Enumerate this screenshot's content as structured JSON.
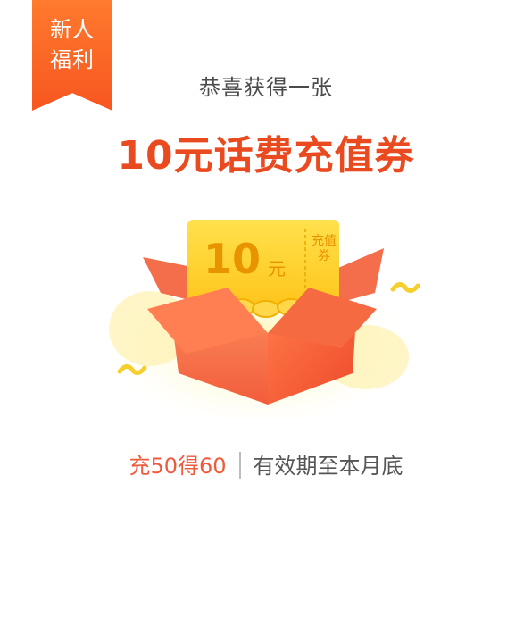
{
  "ribbon": {
    "line1": "新人",
    "line2": "福利"
  },
  "header": {
    "subtitle": "恭喜获得一张",
    "title": "10元话费充值券"
  },
  "coupon": {
    "amount": "10",
    "unit": "元",
    "stub_line1": "充值",
    "stub_line2": "券"
  },
  "info": {
    "left": "充50得60",
    "right": "有效期至本月底"
  },
  "colors": {
    "accent": "#ea4a1f",
    "ribbon": "#f7561f",
    "coupon": "#ffd21a",
    "box": "#f4694d"
  }
}
